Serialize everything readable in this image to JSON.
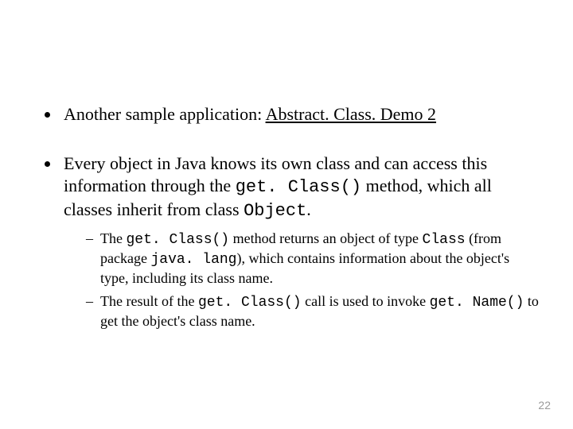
{
  "bullets": [
    {
      "prefix": "Another sample application: ",
      "link": "Abstract. Class. Demo 2"
    },
    {
      "t1": "Every object in Java knows its own class and can access this information through the ",
      "c1": "get. Class()",
      "t2": " method, which all classes inherit from class ",
      "c2": "Object",
      "t3": ".",
      "subs": [
        {
          "t1": "The ",
          "c1": "get. Class()",
          "t2": " method returns an object of type ",
          "c2": "Class",
          "t3": " (from package ",
          "c3": "java. lang",
          "t4": "), which contains information about the object's type, including its class name."
        },
        {
          "t1": "The result of the ",
          "c1": "get. Class()",
          "t2": " call is used to invoke ",
          "c2": "get. Name()",
          "t3": " to get the object's class name."
        }
      ]
    }
  ],
  "page_number": "22"
}
